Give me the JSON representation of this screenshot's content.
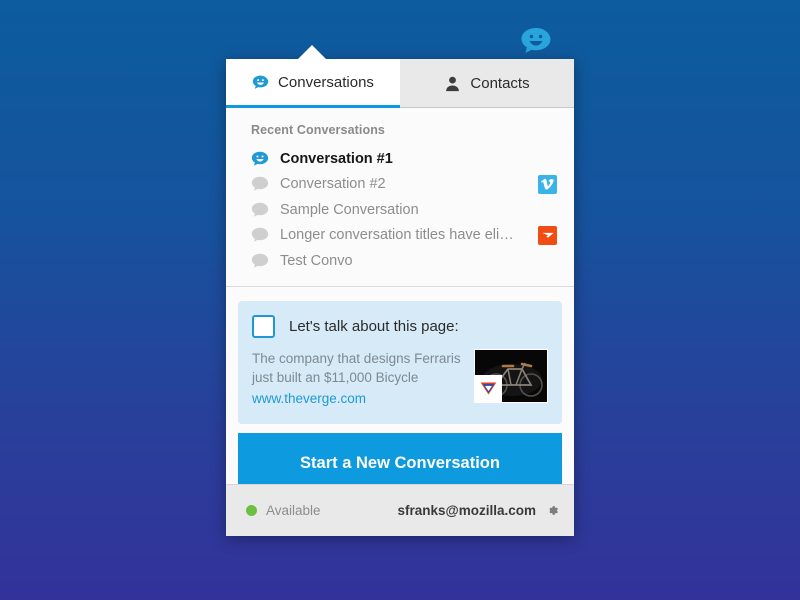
{
  "app": {
    "toolbar_icon": "chat-smiley-bubble-icon"
  },
  "tabs": [
    {
      "id": "conversations",
      "label": "Conversations",
      "icon": "chat-smiley-bubble-icon",
      "active": true
    },
    {
      "id": "contacts",
      "label": "Contacts",
      "icon": "person-icon",
      "active": false
    }
  ],
  "conversations_panel": {
    "list_header": "Recent Conversations",
    "items": [
      {
        "title": "Conversation #1",
        "unread": true,
        "icon": "chat-bubble-active-icon",
        "badge": "none"
      },
      {
        "title": "Conversation #2",
        "unread": false,
        "icon": "chat-bubble-icon",
        "badge": "vimeo-icon"
      },
      {
        "title": "Sample Conversation",
        "unread": false,
        "icon": "chat-bubble-icon",
        "badge": "none"
      },
      {
        "title": "Longer conversation titles have eli…",
        "unread": false,
        "icon": "chat-bubble-icon",
        "badge": "theverge-icon"
      },
      {
        "title": "Test Convo",
        "unread": false,
        "icon": "chat-bubble-icon",
        "badge": "none"
      }
    ]
  },
  "context_card": {
    "checkbox_checked": false,
    "title": "Let's talk about this page:",
    "description_line1": "The company that designs Ferraris",
    "description_line2": "just built an $11,000 Bicycle",
    "link": "www.theverge.com",
    "thumbnail_alt": "bicycle-thumbnail",
    "thumbnail_logo": "theverge-v-logo"
  },
  "cta": {
    "label": "Start a New Conversation"
  },
  "status_bar": {
    "availability": "Available",
    "availability_color": "#6cbe45",
    "account_email": "sfranks@mozilla.com",
    "settings_icon": "gear-icon"
  },
  "colors": {
    "accent": "#0d9ade",
    "background_top": "#0c5c9e",
    "background_bottom": "#33329a",
    "context_card_bg": "#d6eaf7",
    "vimeo_blue": "#3ab4e8",
    "verge_orange": "#f04c13"
  }
}
